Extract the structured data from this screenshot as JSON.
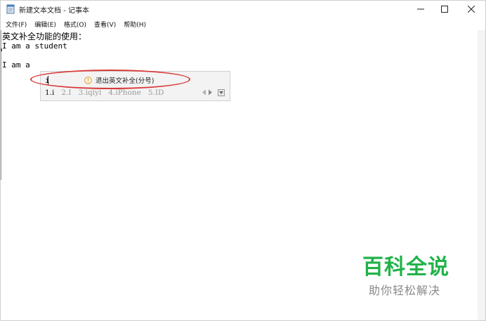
{
  "window": {
    "title": "新建文本文档 - 记事本"
  },
  "menu": {
    "items": [
      "文件(F)",
      "编辑(E)",
      "格式(O)",
      "查看(V)",
      "帮助(H)"
    ]
  },
  "editor": {
    "lines": [
      "英文补全功能的使用：",
      "I am a student",
      "I am a"
    ]
  },
  "ime": {
    "input": "i",
    "hint": "退出英文补全(分号)",
    "candidates": [
      "1.i",
      "2.I",
      "3.iqiyi",
      "4.iPhone",
      "5.ID"
    ],
    "selected_index": 0
  },
  "watermark": {
    "main": "百科全说",
    "sub": "助你轻松解决"
  },
  "colors": {
    "highlight": "#d93a3a",
    "watermark_green": "#21b349"
  }
}
